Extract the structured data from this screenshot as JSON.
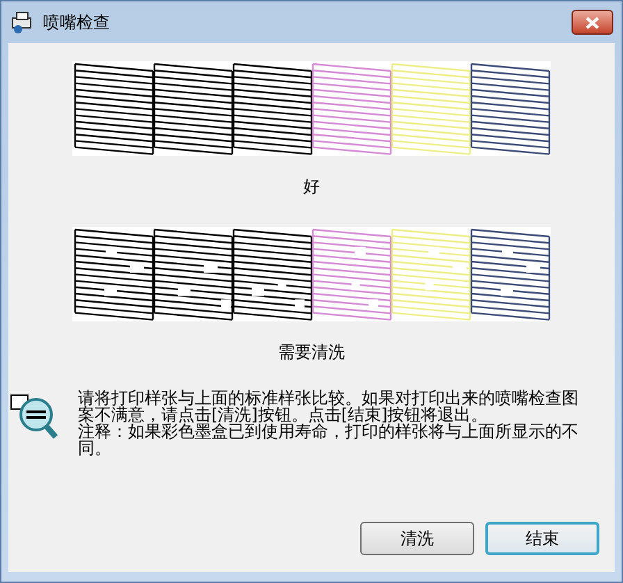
{
  "window": {
    "title": "喷嘴检查"
  },
  "patterns": [
    {
      "label": "好",
      "kind": "good"
    },
    {
      "label": "需要清洗",
      "kind": "clogged"
    }
  ],
  "message": [
    "请将打印样张与上面的标准样张比较。如果对打印出来的喷嘴检查图案不满意，请点击[清洗]按钮。点击[结束]按钮将退出。",
    "注释：如果彩色墨盒已到使用寿命，打印的样张将与上面所显示的不同。"
  ],
  "buttons": [
    {
      "label": "清洗",
      "selected": false
    },
    {
      "label": "结束",
      "selected": true
    }
  ]
}
